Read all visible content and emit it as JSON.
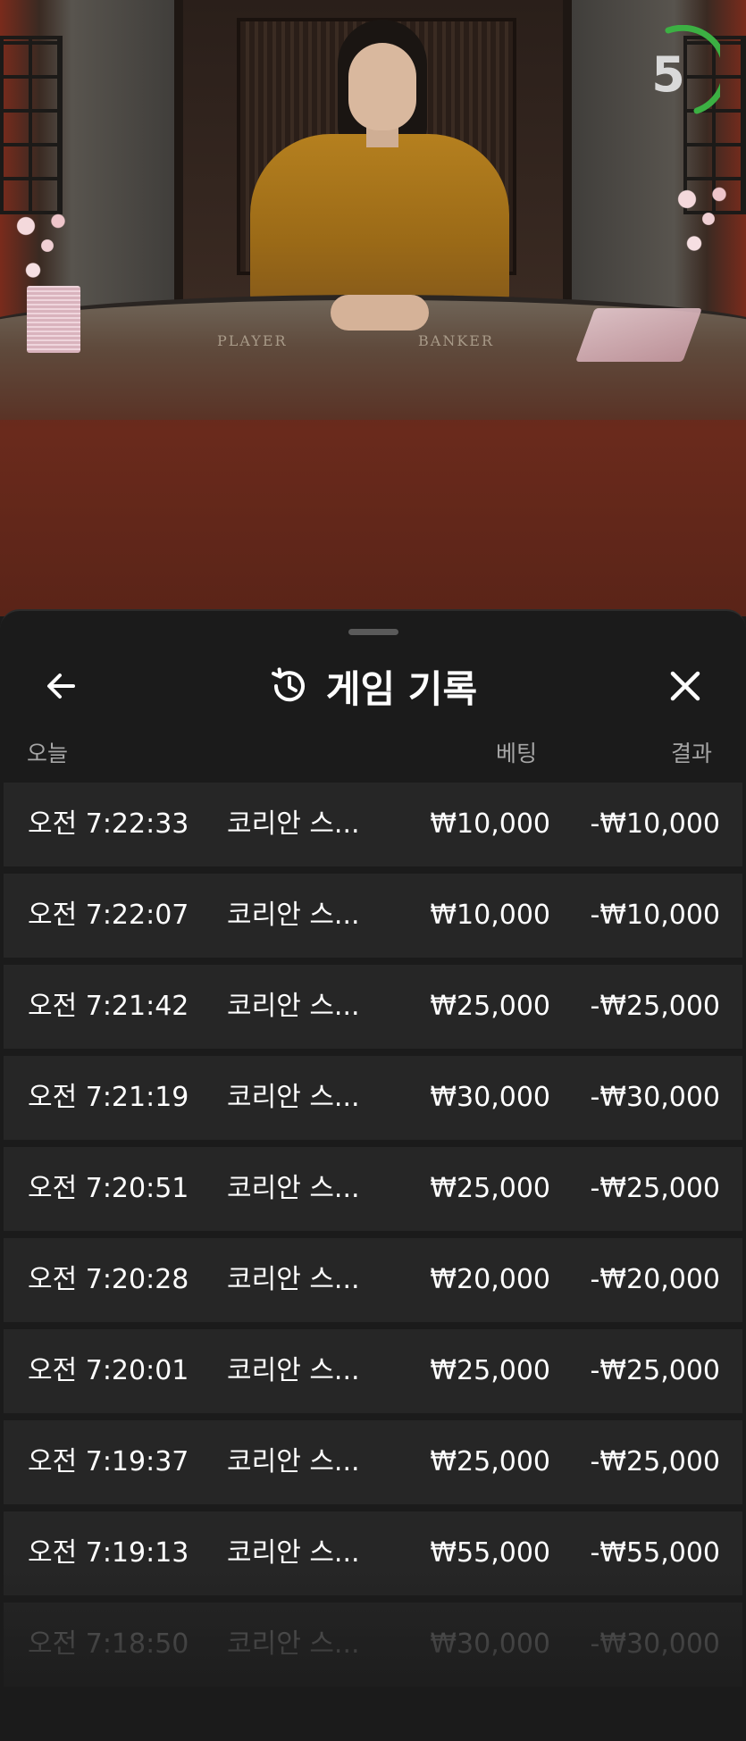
{
  "video": {
    "table_labels": [
      "PLAYER",
      "BANKER"
    ],
    "timer": "5",
    "timer_color": "#3cb043"
  },
  "sheet": {
    "title": "게임 기록",
    "back_icon": "arrow-left-icon",
    "history_icon": "history-icon",
    "close_icon": "close-icon",
    "headers": {
      "date": "오늘",
      "bet": "베팅",
      "result": "결과"
    },
    "rows": [
      {
        "time": "오전 7:22:33",
        "game": "코리안 스...",
        "bet": "₩10,000",
        "result": "-₩10,000"
      },
      {
        "time": "오전 7:22:07",
        "game": "코리안 스...",
        "bet": "₩10,000",
        "result": "-₩10,000"
      },
      {
        "time": "오전 7:21:42",
        "game": "코리안 스...",
        "bet": "₩25,000",
        "result": "-₩25,000"
      },
      {
        "time": "오전 7:21:19",
        "game": "코리안 스...",
        "bet": "₩30,000",
        "result": "-₩30,000"
      },
      {
        "time": "오전 7:20:51",
        "game": "코리안 스...",
        "bet": "₩25,000",
        "result": "-₩25,000"
      },
      {
        "time": "오전 7:20:28",
        "game": "코리안 스...",
        "bet": "₩20,000",
        "result": "-₩20,000"
      },
      {
        "time": "오전 7:20:01",
        "game": "코리안 스...",
        "bet": "₩25,000",
        "result": "-₩25,000"
      },
      {
        "time": "오전 7:19:37",
        "game": "코리안 스...",
        "bet": "₩25,000",
        "result": "-₩25,000"
      },
      {
        "time": "오전 7:19:13",
        "game": "코리안 스...",
        "bet": "₩55,000",
        "result": "-₩55,000"
      },
      {
        "time": "오전 7:18:50",
        "game": "코리안 스...",
        "bet": "₩30,000",
        "result": "-₩30,000"
      }
    ]
  }
}
